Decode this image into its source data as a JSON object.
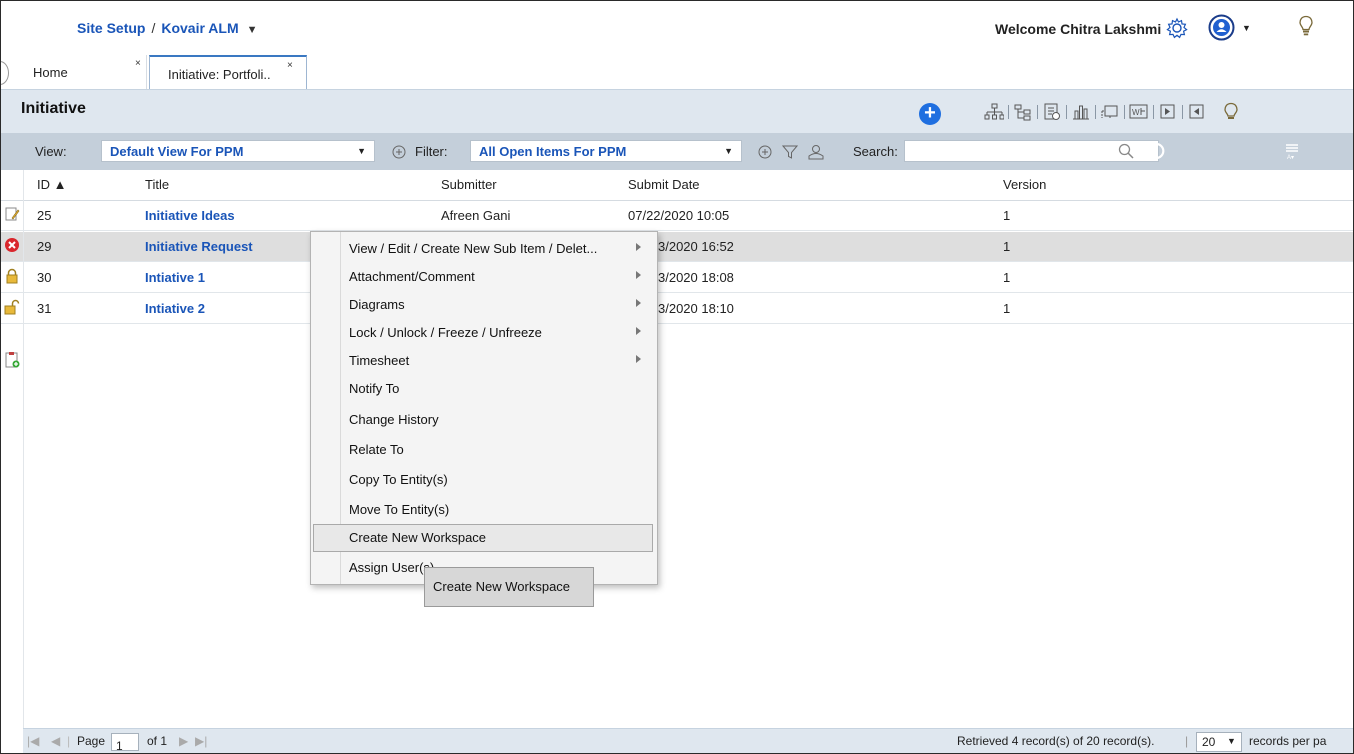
{
  "header": {
    "breadcrumb_site": "Site Setup",
    "breadcrumb_sep": "/",
    "breadcrumb_project": "Kovair ALM",
    "welcome": "Welcome Chitra Lakshmi"
  },
  "tabs": [
    {
      "label": "Home",
      "close": "×"
    },
    {
      "label": "Initiative: Portfoli..",
      "close": "×"
    }
  ],
  "section": {
    "title": "Initiative",
    "add_label": "+",
    "toolbar_icons": [
      "hierarchy-icon",
      "tree-icon",
      "report-icon",
      "chart-icon",
      "diagram-icon",
      "word-export-icon",
      "import-icon",
      "export-icon",
      "idea-bulb-icon"
    ]
  },
  "filterbar": {
    "view_label": "View:",
    "view_value": "Default View For PPM",
    "filter_label": "Filter:",
    "filter_value": "All Open Items For PPM",
    "search_label": "Search:",
    "search_value": ""
  },
  "grid": {
    "columns": [
      "ID ▲",
      "Title",
      "Submitter",
      "Submit Date",
      "Version"
    ],
    "rows": [
      {
        "id": "25",
        "title": "Initiative Ideas",
        "submitter": "Afreen Gani",
        "date": "07/22/2020 10:05",
        "version": "1"
      },
      {
        "id": "29",
        "title": "Initiative Request",
        "submitter": "",
        "date": "3/2020 16:52",
        "version": "1"
      },
      {
        "id": "30",
        "title": "Intiative 1",
        "submitter": "",
        "date": "3/2020 18:08",
        "version": "1"
      },
      {
        "id": "31",
        "title": "Intiative 2",
        "submitter": "",
        "date": "3/2020 18:10",
        "version": "1"
      }
    ]
  },
  "context_menu": {
    "items": [
      {
        "label": "View / Edit / Create New Sub Item / Delet...",
        "submenu": true
      },
      {
        "label": "Attachment/Comment",
        "submenu": true
      },
      {
        "label": "Diagrams",
        "submenu": true
      },
      {
        "label": "Lock / Unlock / Freeze / Unfreeze",
        "submenu": true
      },
      {
        "label": "Timesheet",
        "submenu": true
      },
      {
        "label": "Notify To",
        "submenu": false
      },
      {
        "label": "Change History",
        "submenu": false
      },
      {
        "label": "Relate To",
        "submenu": false
      },
      {
        "label": "Copy To Entity(s)",
        "submenu": false
      },
      {
        "label": "Move To Entity(s)",
        "submenu": false
      },
      {
        "label": "Create New Workspace",
        "submenu": false
      },
      {
        "label": "Assign User(s)",
        "submenu": false
      }
    ],
    "highlighted": "Create New Workspace",
    "tooltip": "Create New Workspace"
  },
  "footer": {
    "page_label": "Page",
    "page_value": "1",
    "of_label": "of 1",
    "retrieved": "Retrieved 4 record(s) of 20 record(s).",
    "per_page_value": "20",
    "per_page_label": "records per pa"
  },
  "colors": {
    "accent": "#1a55b8",
    "toolbar_bg": "#dfe7ef",
    "filterbar_bg": "#c4cfda",
    "add_button": "#1f6fe0"
  }
}
